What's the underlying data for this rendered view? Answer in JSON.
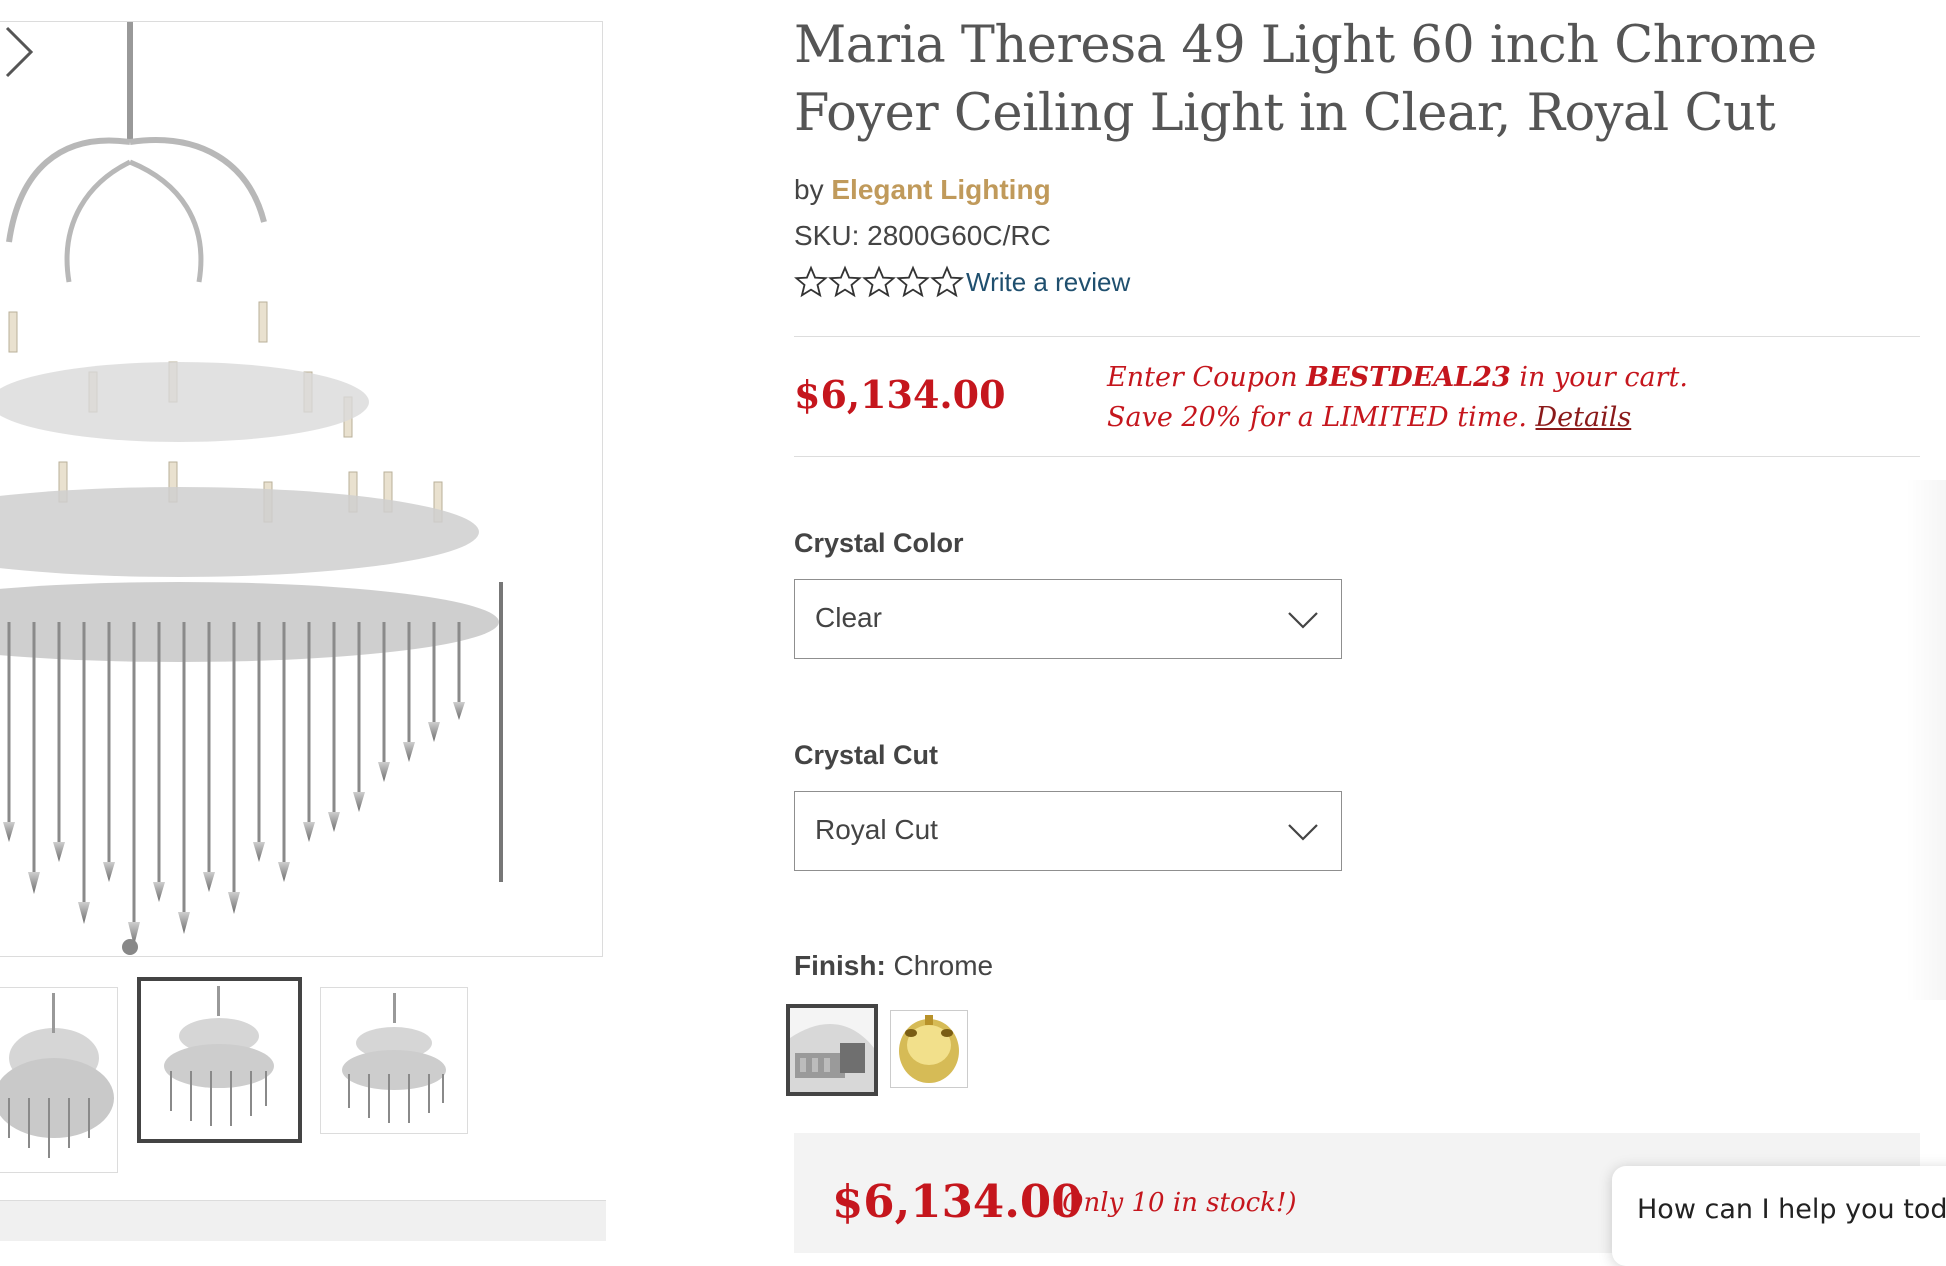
{
  "product": {
    "title": "Maria Theresa 49 Light 60 inch Chrome Foyer Ceiling Light in Clear, Royal Cut",
    "by_prefix": "by",
    "brand": "Elegant Lighting",
    "sku": "SKU: 2800G60C/RC",
    "rating_stars": 0,
    "rating_max": 5,
    "review_link": "Write a review",
    "price": "$6,134.00"
  },
  "promo": {
    "line1_prefix": "Enter Coupon",
    "coupon_code": "BESTDEAL23",
    "line1_suffix": "in your cart.",
    "line2": "Save 20% for a LIMITED time.",
    "details_link": "Details"
  },
  "options": {
    "crystal_color_label": "Crystal Color",
    "crystal_color_value": "Clear",
    "crystal_cut_label": "Crystal Cut",
    "crystal_cut_value": "Royal Cut",
    "finish_label": "Finish:",
    "finish_value": "Chrome",
    "finish_swatches": [
      "Chrome",
      "Gold"
    ]
  },
  "cart": {
    "price": "$6,134.00",
    "stock_note": "(Only 10 in stock!)"
  },
  "chat": {
    "prompt": "How can I help you today"
  },
  "colors": {
    "price_red": "#c5161d",
    "brand_gold": "#c09a5b",
    "link_blue": "#1f4f6e"
  }
}
